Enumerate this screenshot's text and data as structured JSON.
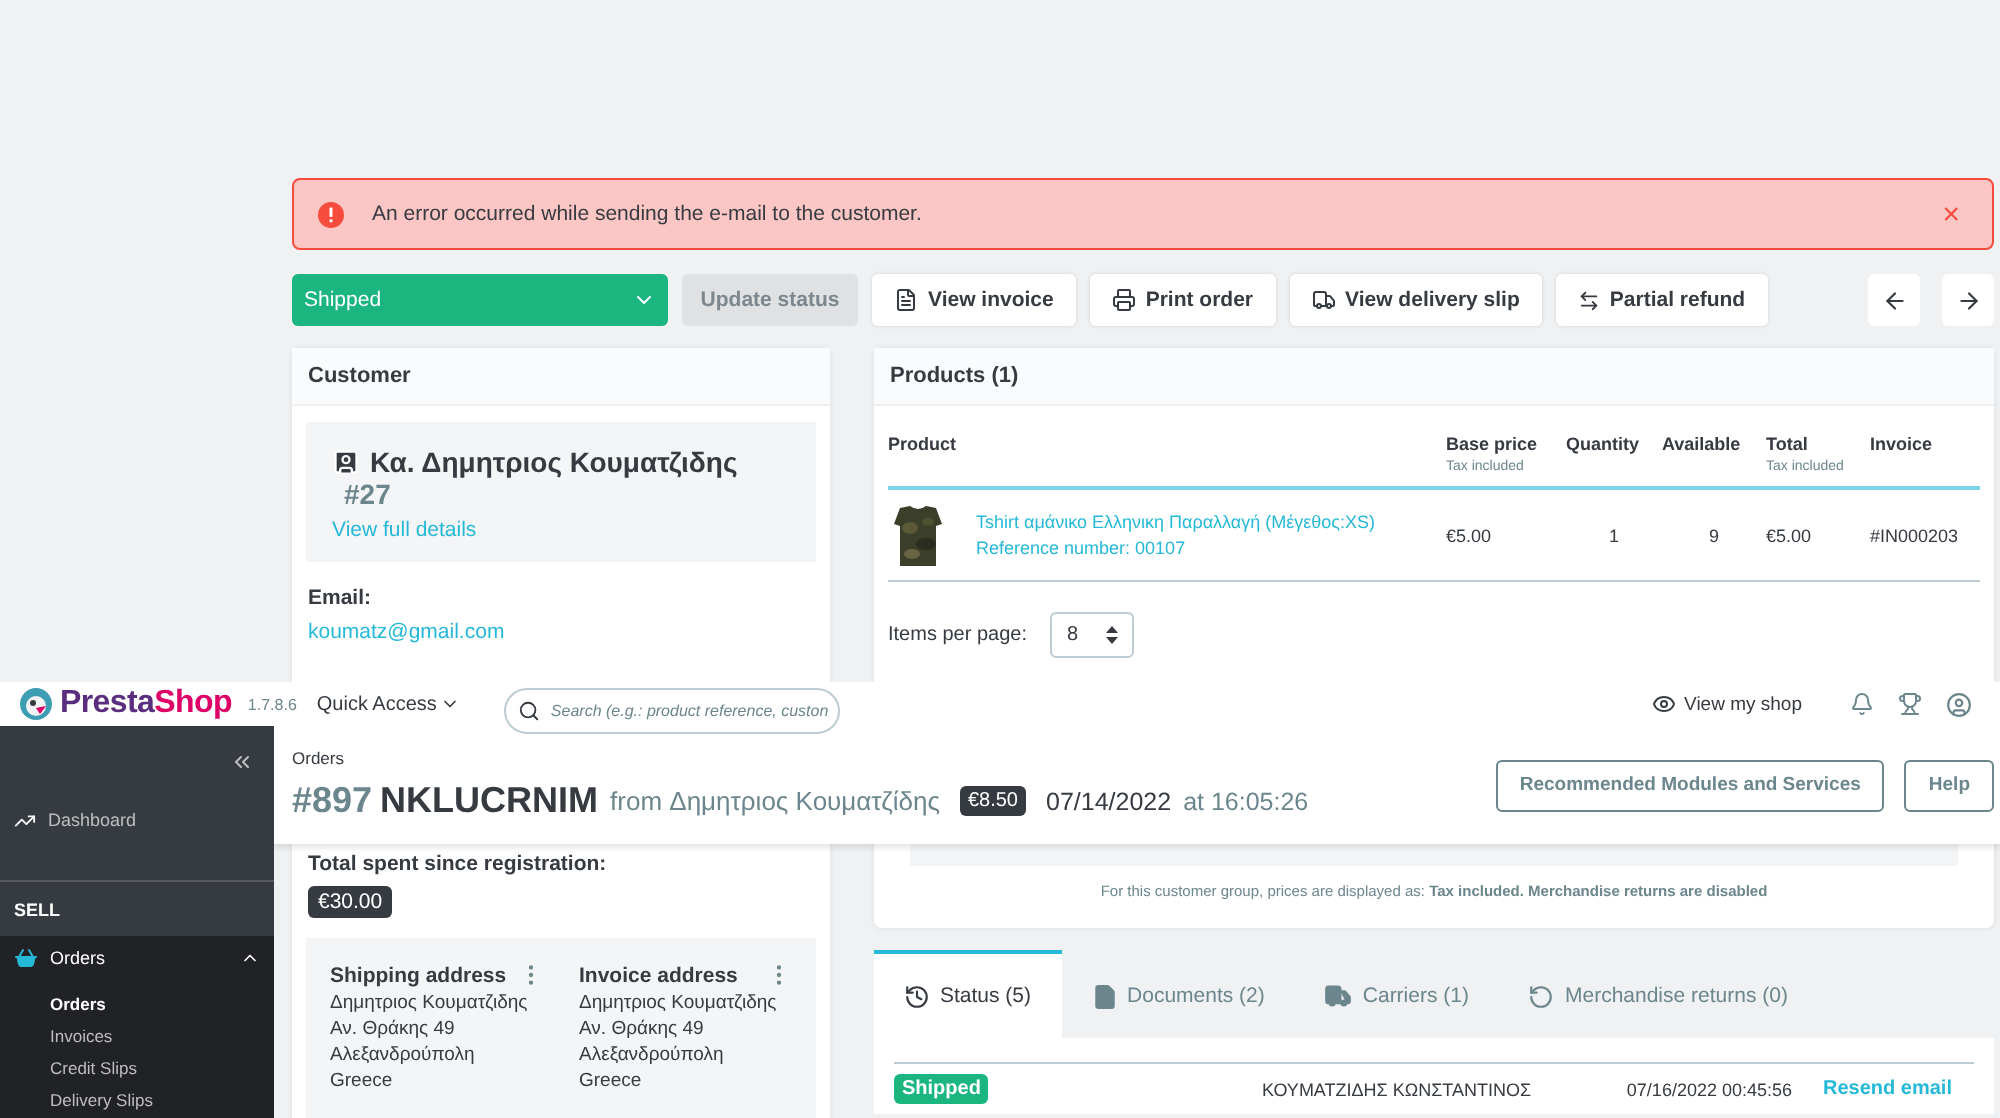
{
  "alert": {
    "message": "An error occurred while sending the e-mail to the customer.",
    "close": "×"
  },
  "actions": {
    "status": {
      "value": "Shipped"
    },
    "update": {
      "label": "Update status",
      "disabled": true
    },
    "buttons": [
      {
        "label": "View invoice"
      },
      {
        "label": "Print order"
      },
      {
        "label": "View delivery slip"
      },
      {
        "label": "Partial refund"
      }
    ]
  },
  "customer": {
    "title": "Customer",
    "name": "Κα. Δημητριος Κουματζιδης",
    "id": "#27",
    "details_link": "View full details",
    "email_label": "Email:",
    "email": "koumatz@gmail.com",
    "spent_label": "Total spent since registration:",
    "spent": "€30.00",
    "addresses": [
      {
        "title": "Shipping address",
        "lines": [
          "Δημητριος Κουματζιδης",
          "Αν. Θράκης 49",
          "Αλεξανδρούπολη",
          "Greece"
        ]
      },
      {
        "title": "Invoice address",
        "lines": [
          "Δημητριος Κουματζιδης",
          "Αν. Θράκης 49",
          "Αλεξανδρούπολη",
          "Greece"
        ]
      }
    ]
  },
  "products": {
    "title": "Products (1)",
    "columns": [
      {
        "label": "Product"
      },
      {
        "label": "Base price",
        "note": "Tax included"
      },
      {
        "label": "Quantity"
      },
      {
        "label": "Available"
      },
      {
        "label": "Total",
        "note": "Tax included"
      },
      {
        "label": "Invoice"
      }
    ],
    "rows": [
      {
        "name": "Tshirt αμάνικο Ελληνικη Παραλλαγή (Μέγεθος:XS)",
        "reference": "Reference number: 00107",
        "base_price": "€5.00",
        "quantity": "1",
        "available": "9",
        "total": "€5.00",
        "invoice": "#IN000203"
      }
    ],
    "items_per_page_label": "Items per page:",
    "items_per_page": "8",
    "note_plain": "For this customer group, prices are displayed as: ",
    "note_bold": "Tax included. Merchandise returns are disabled"
  },
  "tabs": [
    {
      "label": "Status (5)",
      "selected": true
    },
    {
      "label": "Documents (2)",
      "selected": false
    },
    {
      "label": "Carriers (1)",
      "selected": false
    },
    {
      "label": "Merchandise returns (0)",
      "selected": false
    }
  ],
  "status_rows": [
    {
      "status": "Shipped",
      "employee": "ΚΟΥΜΑΤΖΙΔΗΣ ΚΩΝΣΤΑΝΤΙΝΟΣ",
      "date": "07/16/2022 00:45:56",
      "action": "Resend email"
    }
  ],
  "header": {
    "brand_first": "Presta",
    "brand_second": "Shop",
    "version": "1.7.8.6",
    "quick_access": "Quick Access",
    "search": {
      "placeholder": "Search (e.g.: product reference, custon"
    },
    "view_shop": "View my shop"
  },
  "sidebar": {
    "items": [
      {
        "kind": "link",
        "label": "Dashboard"
      },
      {
        "kind": "section",
        "label": "SELL"
      },
      {
        "kind": "group",
        "label": "Orders",
        "expanded": true,
        "children": [
          {
            "label": "Orders",
            "selected": true
          },
          {
            "label": "Invoices",
            "selected": false
          },
          {
            "label": "Credit Slips",
            "selected": false
          },
          {
            "label": "Delivery Slips",
            "selected": false
          }
        ]
      }
    ]
  },
  "toolbar": {
    "breadcrumb": "Orders",
    "order_id": "#897",
    "reference": "NKLUCRNIM",
    "from": "from Δημητριος Κουματζίδης",
    "total": "€8.50",
    "date": "07/14/2022",
    "time": "at 16:05:26",
    "buttons": [
      "Recommended Modules and Services",
      "Help"
    ]
  }
}
